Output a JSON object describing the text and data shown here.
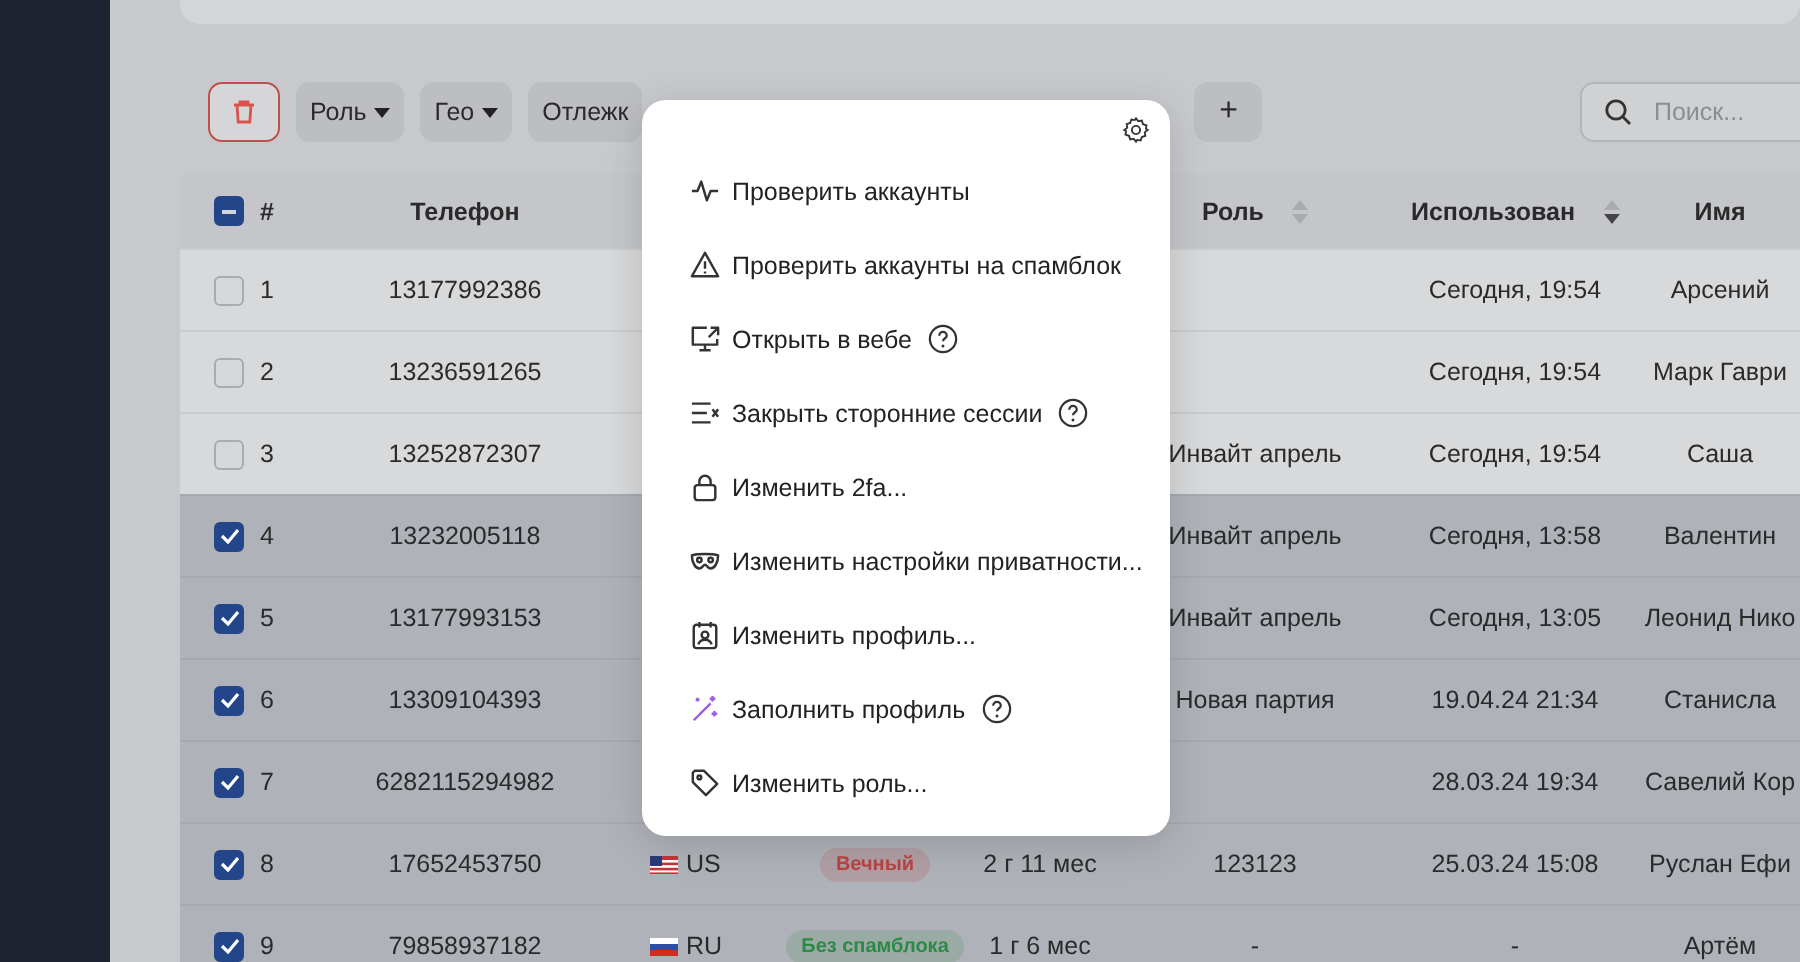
{
  "toolbar": {
    "filters": [
      "Роль",
      "Гео",
      "Отлежк"
    ],
    "add": "+",
    "search": {
      "placeholder": "Поиск..."
    }
  },
  "table": {
    "all_indeterminate": true,
    "columns": [
      {
        "label": "#"
      },
      {
        "label": "Телефон"
      },
      {
        "label": "Роль",
        "sort_active": false
      },
      {
        "label": "Использован",
        "sort_active": true
      },
      {
        "label": "Имя"
      }
    ],
    "rows": [
      {
        "selected": false,
        "num": "1",
        "phone": "13177992386",
        "used": "Сегодня, 19:54",
        "name": "Арсений"
      },
      {
        "selected": false,
        "num": "2",
        "phone": "13236591265",
        "used": "Сегодня, 19:54",
        "name": "Марк Гаври"
      },
      {
        "selected": false,
        "num": "3",
        "phone": "13252872307",
        "role": "Инвайт апрель",
        "used": "Сегодня, 19:54",
        "name": "Саша"
      },
      {
        "selected": true,
        "num": "4",
        "phone": "13232005118",
        "role": "Инвайт апрель",
        "used": "Сегодня, 13:58",
        "name": "Валентин"
      },
      {
        "selected": true,
        "num": "5",
        "phone": "13177993153",
        "role": "Инвайт апрель",
        "used": "Сегодня, 13:05",
        "name": "Леонид Нико"
      },
      {
        "selected": true,
        "num": "6",
        "phone": "13309104393",
        "role": "Новая партия",
        "used": "19.04.24 21:34",
        "name": "Станисла"
      },
      {
        "selected": true,
        "num": "7",
        "phone": "6282115294982",
        "used": "28.03.24 19:34",
        "name": "Савелий Кор"
      },
      {
        "selected": true,
        "num": "8",
        "phone": "17652453750",
        "geo": {
          "kind": "us",
          "code": "US"
        },
        "status": {
          "label": "Вечный",
          "color": "#b84444"
        },
        "age": "2 г 11 мес",
        "role": "123123",
        "used": "25.03.24 15:08",
        "name": "Руслан Ефи"
      },
      {
        "selected": true,
        "num": "9",
        "phone": "79858937182",
        "geo": {
          "kind": "ru",
          "code": "RU"
        },
        "status": {
          "label": "Без спамблока",
          "color": "#2b8a45"
        },
        "age": "1 г 6 мес",
        "role": "-",
        "used": "-",
        "name": "Артём"
      }
    ]
  },
  "menu": {
    "items": [
      {
        "label": "Проверить аккаунты",
        "help": false
      },
      {
        "label": "Проверить аккаунты на спамблок",
        "help": false
      },
      {
        "label": "Открыть в вебе",
        "help": true
      },
      {
        "label": "Закрыть сторонние сессии",
        "help": true
      },
      {
        "label": "Изменить 2fa...",
        "help": false
      },
      {
        "label": "Изменить настройки приватности...",
        "help": false
      },
      {
        "label": "Изменить профиль...",
        "help": false
      },
      {
        "label": "Заполнить профиль",
        "help": true
      },
      {
        "label": "Изменить роль...",
        "help": false
      }
    ]
  }
}
